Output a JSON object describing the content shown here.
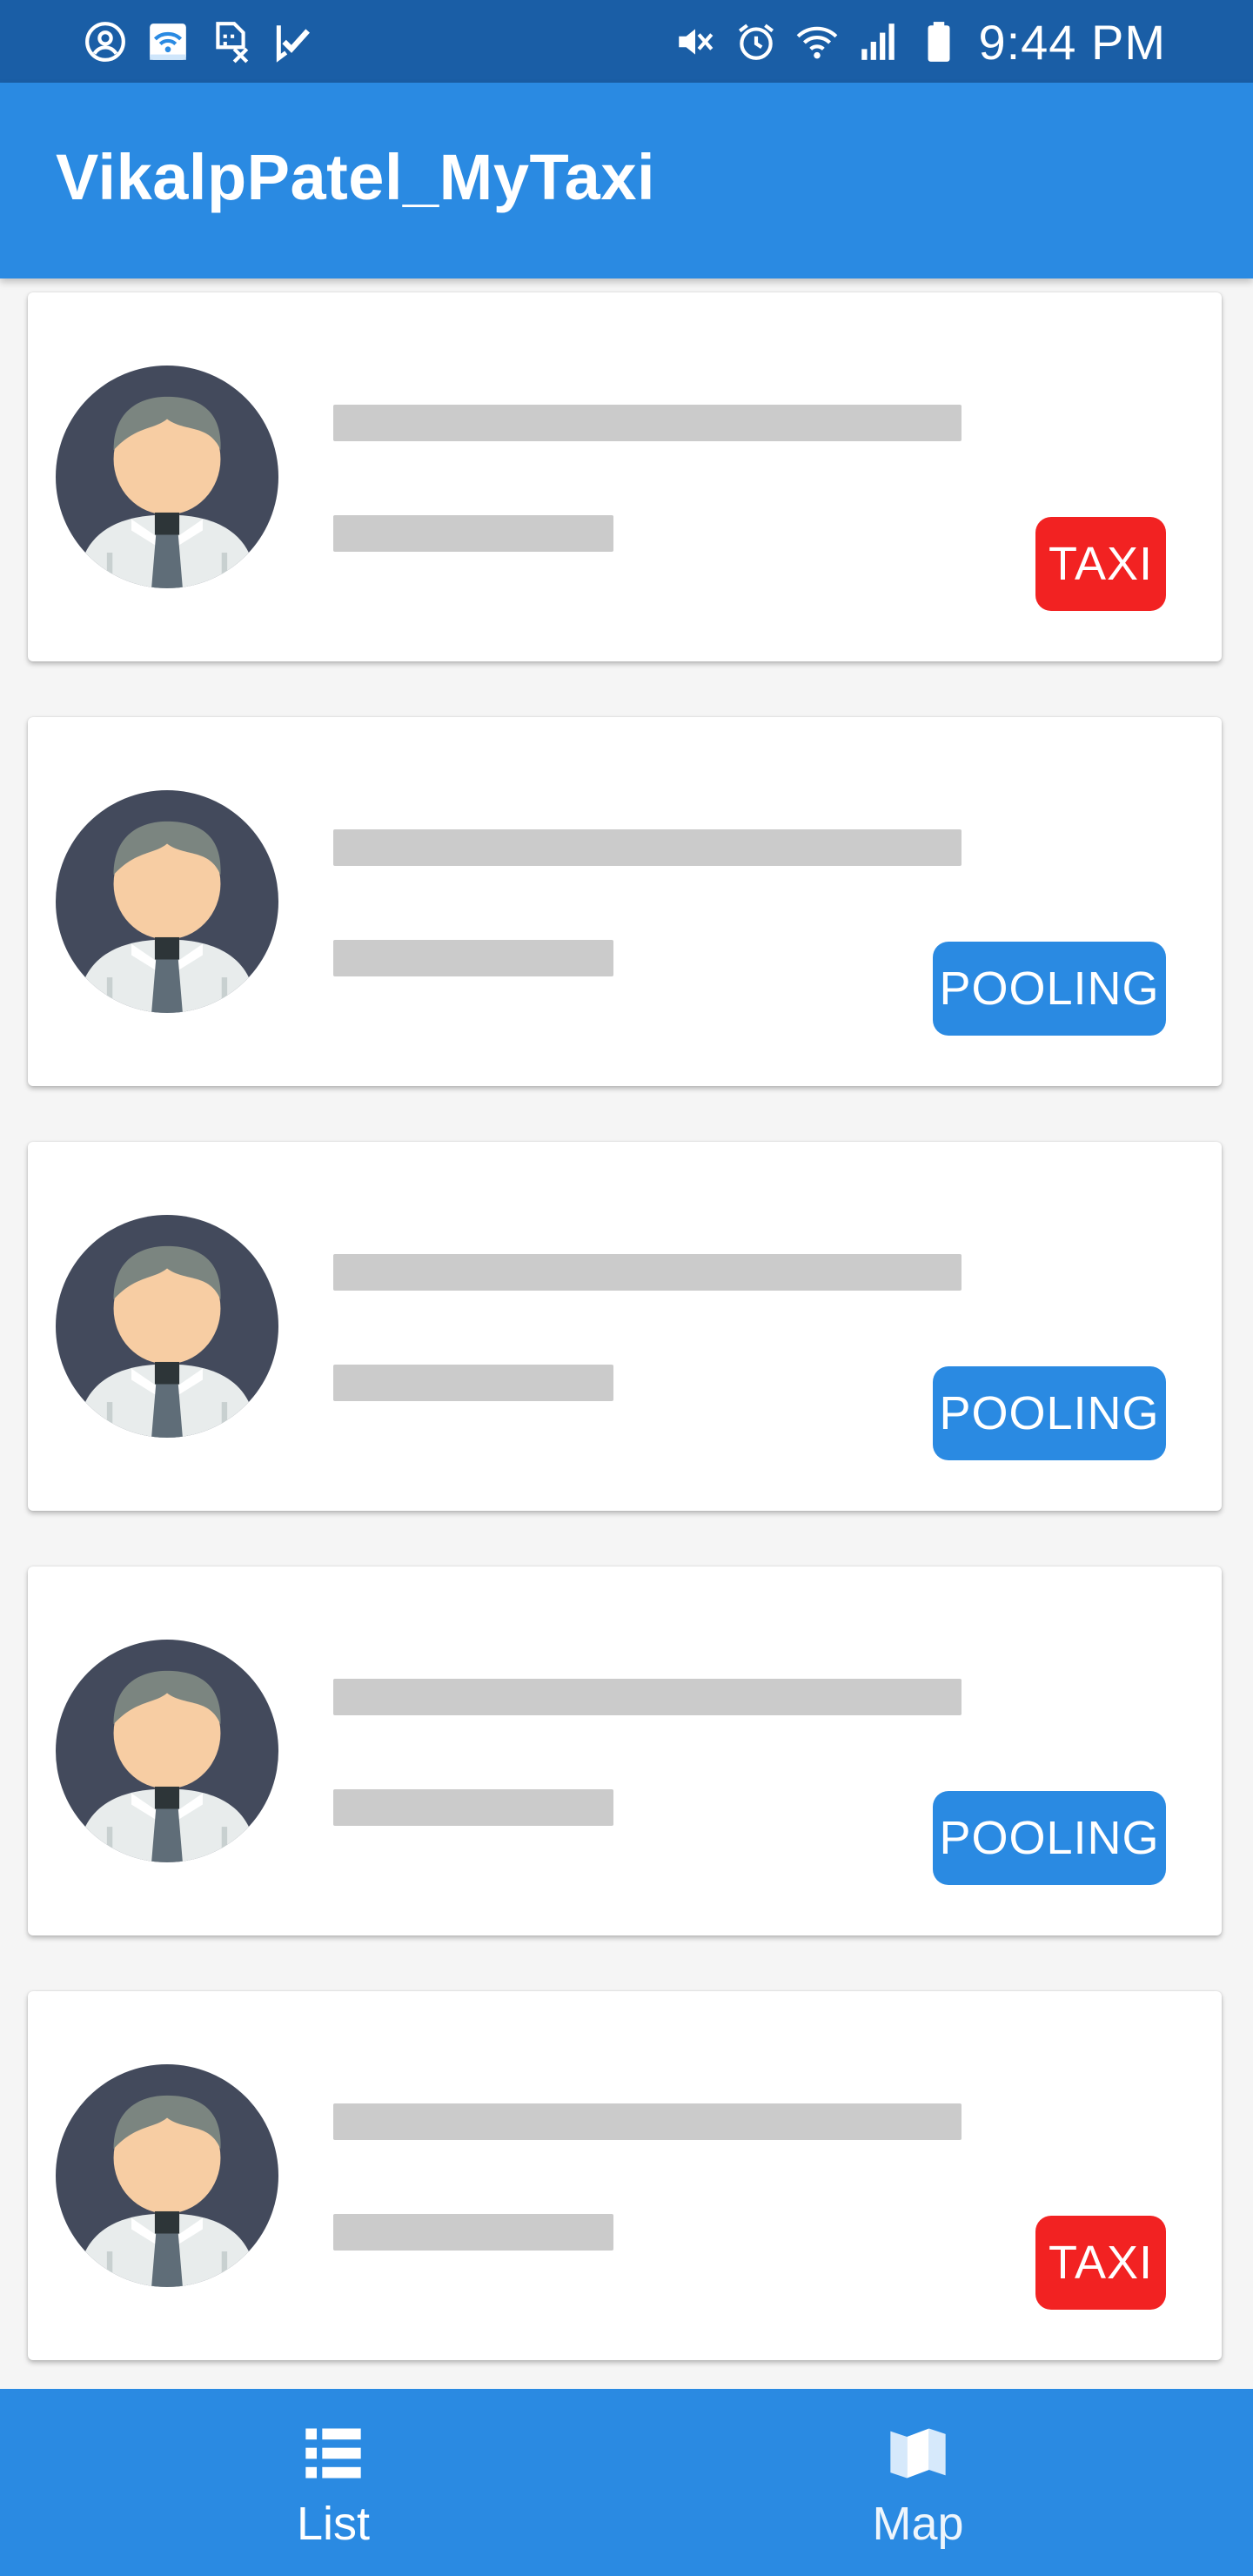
{
  "status_bar": {
    "time": "9:44 PM",
    "left_icons": [
      "account-circle-icon",
      "wifi-settings-icon",
      "sim-no-icon",
      "check-icon"
    ],
    "right_icons": [
      "mute-icon",
      "alarm-icon",
      "wifi-icon",
      "signal-icon",
      "battery-icon"
    ]
  },
  "app_bar": {
    "title": "VikalpPatel_MyTaxi"
  },
  "colors": {
    "status_bar": "#1a5ea6",
    "primary": "#2a8ae2",
    "taxi_badge": "#f22222",
    "pooling_badge": "#2a8ae2",
    "placeholder": "#cbcbcb"
  },
  "vehicles": [
    {
      "badge": "TAXI",
      "type": "taxi"
    },
    {
      "badge": "POOLING",
      "type": "pooling"
    },
    {
      "badge": "POOLING",
      "type": "pooling"
    },
    {
      "badge": "POOLING",
      "type": "pooling"
    },
    {
      "badge": "TAXI",
      "type": "taxi"
    }
  ],
  "bottom_nav": {
    "items": [
      {
        "label": "List",
        "icon": "list-icon",
        "active": true
      },
      {
        "label": "Map",
        "icon": "map-icon",
        "active": false
      }
    ]
  }
}
